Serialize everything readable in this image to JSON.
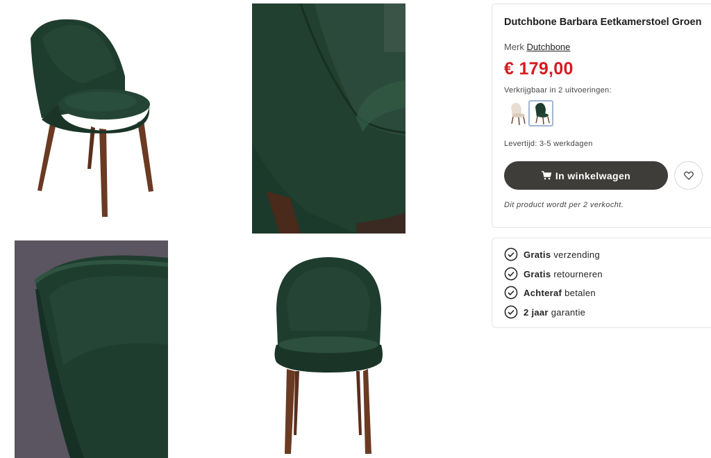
{
  "gallery": {
    "images": [
      {
        "label": "product-photo-side"
      },
      {
        "label": "product-photo-detail-seat"
      },
      {
        "label": "product-photo-detail-back"
      },
      {
        "label": "product-photo-front"
      }
    ]
  },
  "product": {
    "title": "Dutchbone Barbara Eetkamerstoel Groen",
    "brand_prefix": "Merk",
    "brand_name": "Dutchbone",
    "price": "€ 179,00",
    "variants_label": "Verkrijgbaar in 2 uitvoeringen:",
    "delivery": "Levertijd: 3-5 werkdagen",
    "cart_button": "In winkelwagen",
    "note": "Dit product wordt per 2 verkocht."
  },
  "usps": [
    {
      "bold": "Gratis",
      "text": "verzending"
    },
    {
      "bold": "Gratis",
      "text": "retourneren"
    },
    {
      "bold": "Achteraf",
      "text": "betalen"
    },
    {
      "bold": "2 jaar",
      "text": "garantie"
    }
  ],
  "colors": {
    "price": "#d71920",
    "button": "#3f3d3a",
    "velvet_green": "#1f3d2f",
    "wood": "#6b3a22"
  },
  "icons": {
    "cart": "cart-icon",
    "wishlist": "heart-icon",
    "check": "check-circle-icon"
  }
}
